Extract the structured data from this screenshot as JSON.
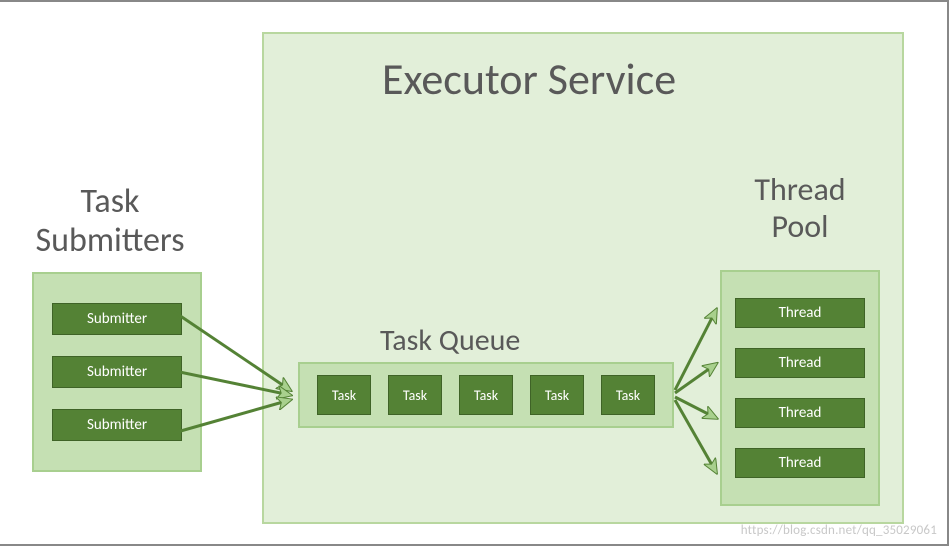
{
  "titles": {
    "main": "Executor Service",
    "submitters": "Task\nSubmitters",
    "queue": "Task Queue",
    "pool": "Thread\nPool"
  },
  "submitters": [
    "Submitter",
    "Submitter",
    "Submitter"
  ],
  "tasks": [
    "Task",
    "Task",
    "Task",
    "Task",
    "Task"
  ],
  "threads": [
    "Thread",
    "Thread",
    "Thread",
    "Thread"
  ],
  "colors": {
    "panel_light": "#e2efd9",
    "panel_mid": "#c5e0b3",
    "panel_border": "#a8cf8f",
    "box_fill": "#548235",
    "text": "#595959",
    "arrow_fill": "#a8d08d",
    "arrow_stroke": "#548235"
  },
  "watermark": "https://blog.csdn.net/qq_35029061"
}
